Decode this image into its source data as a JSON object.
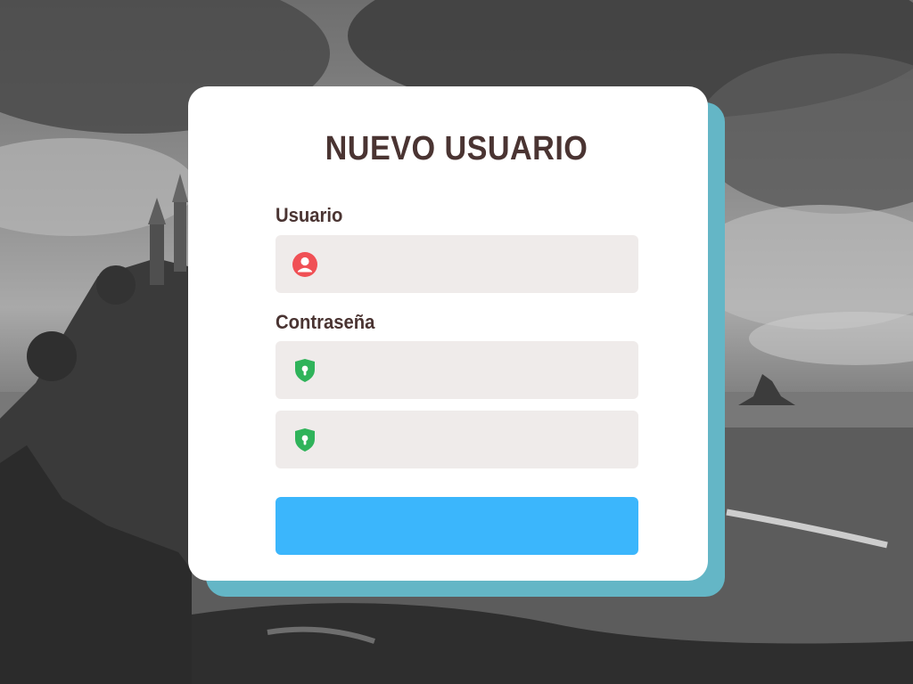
{
  "form": {
    "title": "NUEVO USUARIO",
    "username_label": "Usuario",
    "password_label": "Contraseña",
    "username_value": "",
    "password_value": "",
    "password_confirm_value": "",
    "submit_label": ""
  },
  "icons": {
    "user": "user-circle-icon",
    "password": "shield-lock-icon",
    "password_confirm": "shield-lock-icon"
  },
  "colors": {
    "title_text": "#4a3432",
    "card": "#ffffff",
    "card_shadow": "#64b6c6",
    "field_bg": "#efebea",
    "user_icon": "#f05055",
    "lock_icon": "#2fb35a",
    "submit": "#3bb6fc"
  }
}
